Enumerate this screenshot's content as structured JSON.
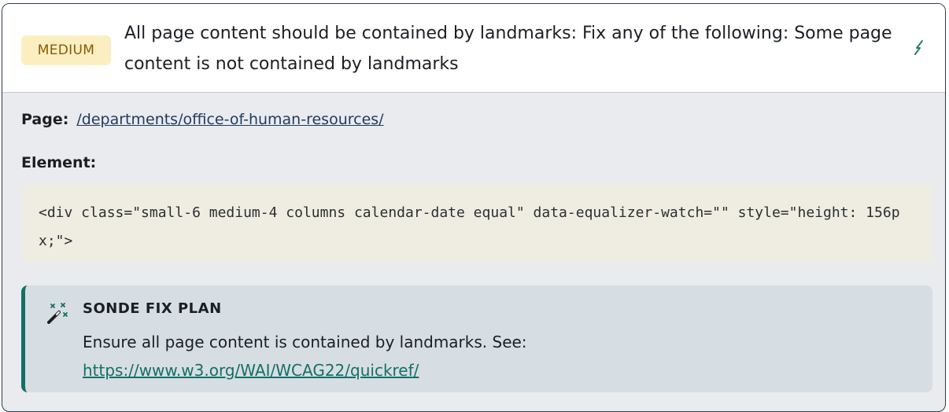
{
  "issue": {
    "severity": "MEDIUM",
    "title": "All page content should be contained by landmarks: Fix any of the following: Some page content is not contained by landmarks",
    "icons": {
      "edit": "edit-pen-icon",
      "fix": "magic-wand-icon"
    },
    "colors": {
      "severity_bg": "#fbefc2",
      "severity_text": "#8a5a00",
      "accent": "#127064"
    }
  },
  "details": {
    "page_label": "Page:",
    "page_url": "/departments/office-of-human-resources/",
    "element_label": "Element:",
    "element_code": "<div class=\"small-6 medium-4 columns calendar-date equal\" data-equalizer-watch=\"\" style=\"height: 156px;\">"
  },
  "fix_plan": {
    "title": "SONDE FIX PLAN",
    "text": "Ensure all page content is contained by landmarks. See:",
    "link": "https://www.w3.org/WAI/WCAG22/quickref/"
  }
}
